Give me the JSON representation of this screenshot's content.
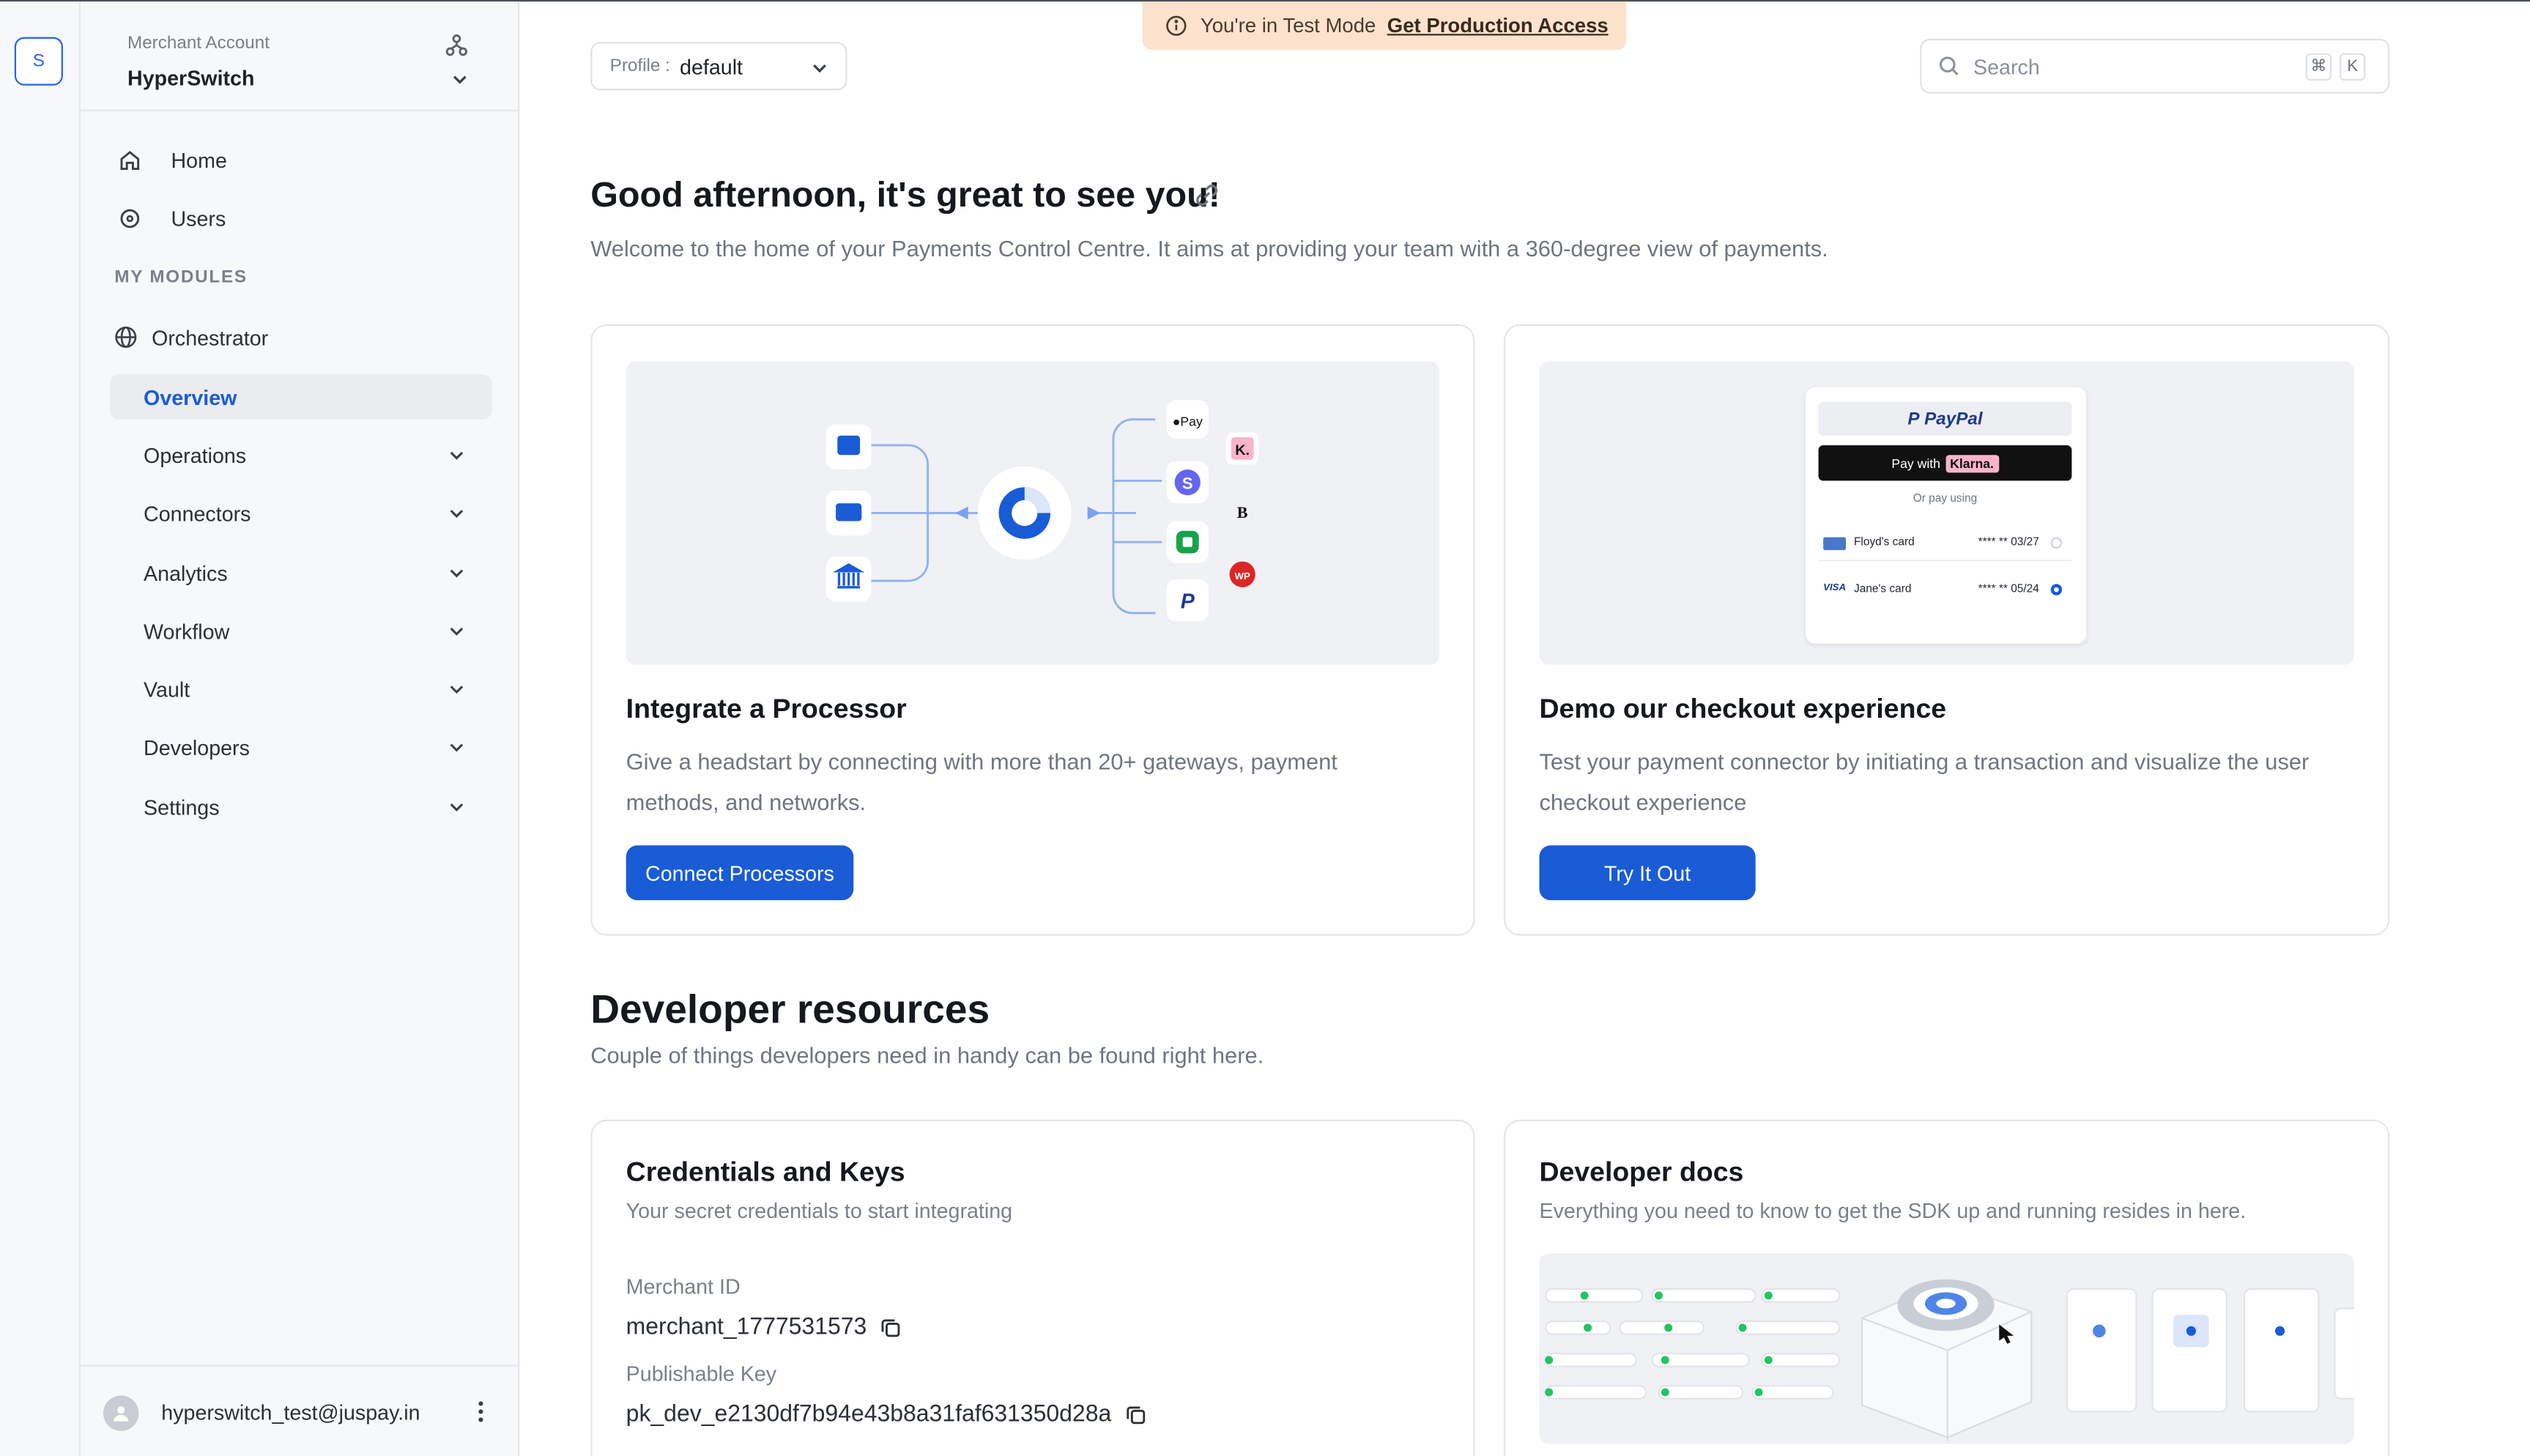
{
  "rail": {
    "avatar_letter": "S"
  },
  "account": {
    "label": "Merchant Account",
    "name": "HyperSwitch"
  },
  "nav": {
    "home": "Home",
    "users": "Users",
    "section": "MY MODULES",
    "orchestrator": "Orchestrator",
    "items": [
      "Overview",
      "Operations",
      "Connectors",
      "Analytics",
      "Workflow",
      "Vault",
      "Developers",
      "Settings"
    ]
  },
  "user": {
    "email": "hyperswitch_test@juspay.in"
  },
  "banner": {
    "text": "You're in Test Mode",
    "link": "Get Production Access"
  },
  "profile": {
    "label": "Profile :",
    "value": "default"
  },
  "search": {
    "placeholder": "Search",
    "key1": "⌘",
    "key2": "K"
  },
  "greeting": {
    "title": "Good afternoon, it's great to see you!",
    "subtitle": "Welcome to the home of your Payments Control Centre. It aims at providing your team with a 360-degree view of payments."
  },
  "cards": {
    "integrate": {
      "title": "Integrate a Processor",
      "desc": "Give a headstart by connecting with more than 20+ gateways, payment methods, and networks.",
      "button": "Connect Processors"
    },
    "demo": {
      "title": "Demo our checkout experience",
      "desc": "Test your payment connector by initiating a transaction and visualize the user checkout experience",
      "button": "Try It Out",
      "preview": {
        "paypal": "PayPal",
        "pay_with": "Pay with",
        "klarna": "Klarna.",
        "or": "Or pay using",
        "card1_name": "Floyd's card",
        "card1_num": "**** ** 03/27",
        "card2_name": "Jane's card",
        "card2_num": "**** ** 05/24",
        "visa": "VISA"
      }
    }
  },
  "developer": {
    "title": "Developer resources",
    "subtitle": "Couple of things developers need in handy can be found right here.",
    "credentials": {
      "title": "Credentials and Keys",
      "subtitle": "Your secret credentials to start integrating",
      "merchant_id_label": "Merchant ID",
      "merchant_id": "merchant_1777531573",
      "publishable_key_label": "Publishable Key",
      "publishable_key": "pk_dev_e2130df7b94e43b8a31faf631350d28a"
    },
    "docs": {
      "title": "Developer docs",
      "subtitle": "Everything you need to know to get the SDK up and running resides in here."
    }
  },
  "colors": {
    "accent": "#1a5bd6",
    "banner_bg": "#fde3cd",
    "sidebar_bg": "#f7f8fa"
  }
}
